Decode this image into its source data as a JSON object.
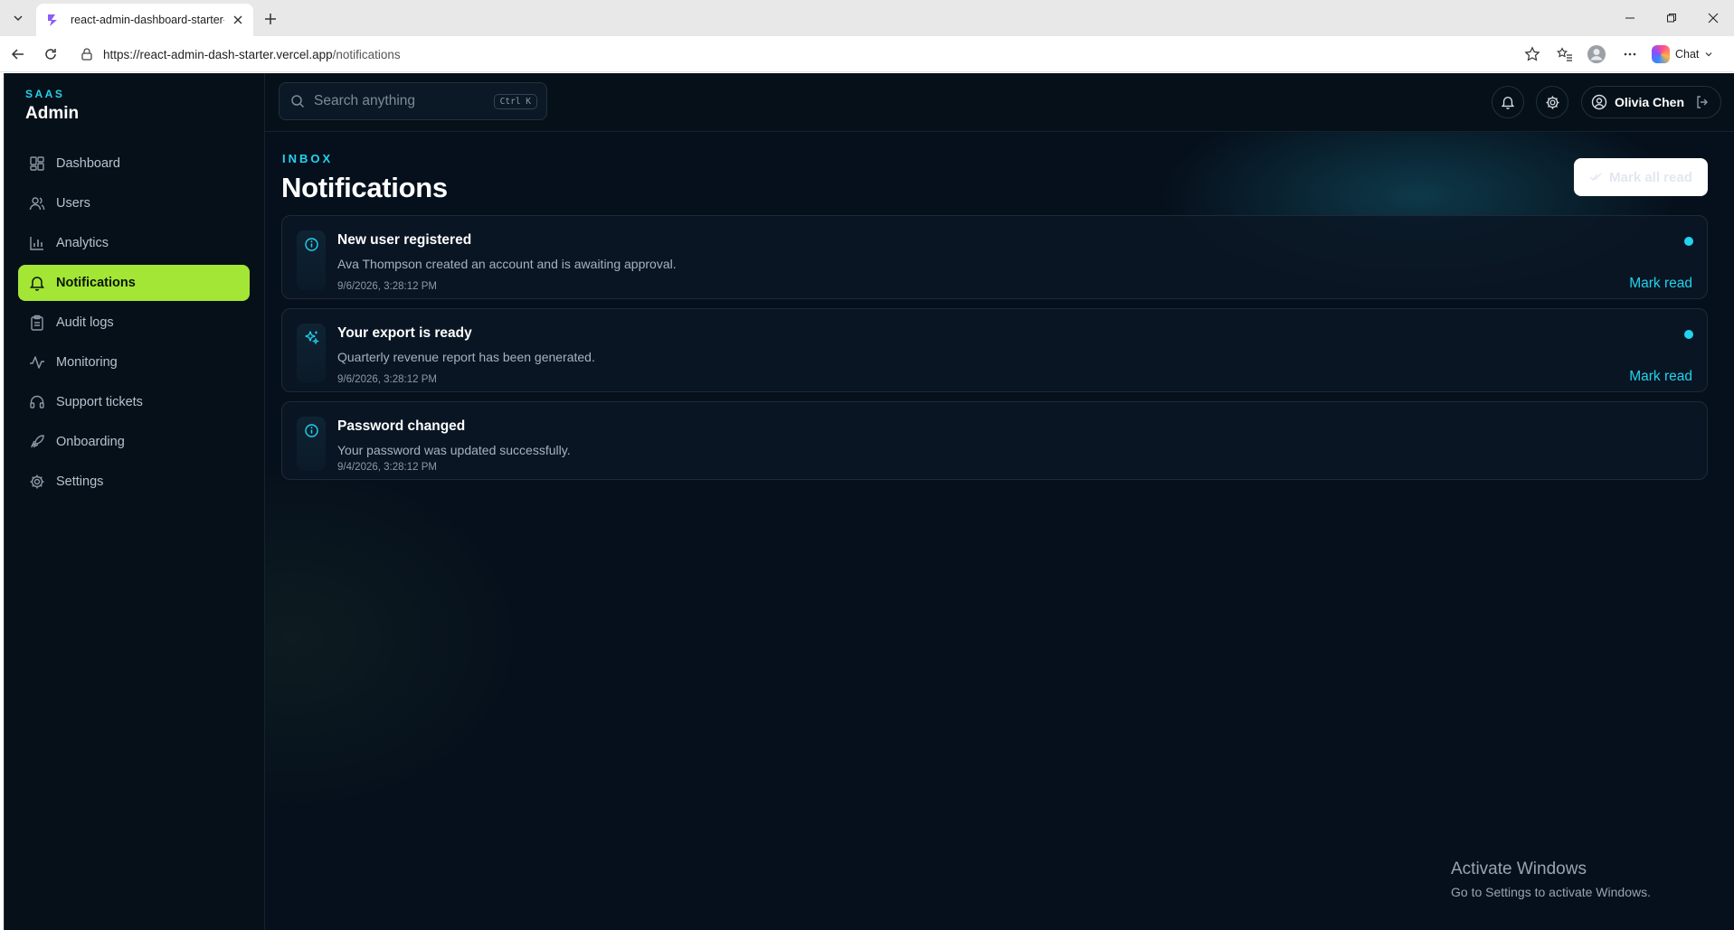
{
  "browser": {
    "tab_title": "react-admin-dashboard-starter-te",
    "url_host": "https://react-admin-dash-starter.vercel.app",
    "url_path": "/notifications",
    "chat_label": "Chat"
  },
  "brand": {
    "small": "SAAS",
    "big": "Admin"
  },
  "sidebar": {
    "items": [
      {
        "label": "Dashboard",
        "icon": "dashboard-icon"
      },
      {
        "label": "Users",
        "icon": "users-icon"
      },
      {
        "label": "Analytics",
        "icon": "analytics-icon"
      },
      {
        "label": "Notifications",
        "icon": "bell-icon",
        "active": true
      },
      {
        "label": "Audit logs",
        "icon": "clipboard-icon"
      },
      {
        "label": "Monitoring",
        "icon": "activity-icon"
      },
      {
        "label": "Support tickets",
        "icon": "headset-icon"
      },
      {
        "label": "Onboarding",
        "icon": "rocket-icon"
      },
      {
        "label": "Settings",
        "icon": "gear-icon"
      }
    ]
  },
  "topbar": {
    "search_placeholder": "Search anything",
    "shortcut": "Ctrl K",
    "user_name": "Olivia Chen"
  },
  "page": {
    "eyebrow": "INBOX",
    "title": "Notifications",
    "mark_all_label": "Mark all read"
  },
  "notifications": [
    {
      "title": "New user registered",
      "body": "Ava Thompson created an account and is awaiting approval.",
      "time": "9/6/2026, 3:28:12 PM",
      "unread": true,
      "action": "Mark read",
      "icon": "info-icon"
    },
    {
      "title": "Your export is ready",
      "body": "Quarterly revenue report has been generated.",
      "time": "9/6/2026, 3:28:12 PM",
      "unread": true,
      "action": "Mark read",
      "icon": "sparkles-icon"
    },
    {
      "title": "Password changed",
      "body": "Your password was updated successfully.",
      "time": "9/4/2026, 3:28:12 PM",
      "unread": false,
      "action": "",
      "icon": "info-icon"
    }
  ],
  "watermark": {
    "line1": "Activate Windows",
    "line2": "Go to Settings to activate Windows."
  },
  "colors": {
    "accent": "#22d3ee",
    "active_nav": "#a3e635",
    "background": "#06101c"
  }
}
